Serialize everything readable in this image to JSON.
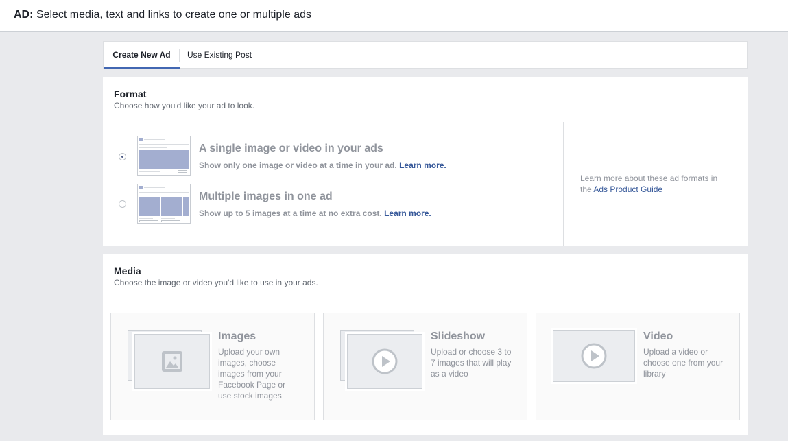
{
  "header": {
    "prefix": "AD:",
    "title": "Select media, text and links to create one or multiple ads"
  },
  "tabs": [
    {
      "label": "Create New Ad",
      "active": true
    },
    {
      "label": "Use Existing Post",
      "active": false
    }
  ],
  "format": {
    "title": "Format",
    "subtitle": "Choose how you'd like your ad to look.",
    "options": [
      {
        "title": "A single image or video in your ads",
        "description": "Show only one image or video at a time in your ad.",
        "link": "Learn more.",
        "selected": true
      },
      {
        "title": "Multiple images in one ad",
        "description": "Show up to 5 images at a time at no extra cost.",
        "link": "Learn more.",
        "selected": false
      }
    ],
    "side_note": "Learn more about these ad formats in the",
    "side_link": "Ads Product Guide"
  },
  "media": {
    "title": "Media",
    "subtitle": "Choose the image or video you'd like to use in your ads.",
    "options": [
      {
        "title": "Images",
        "description": "Upload your own images, choose images from your Facebook Page or use stock images",
        "icon": "image-icon"
      },
      {
        "title": "Slideshow",
        "description": "Upload or choose 3 to 7 images that will play as a video",
        "icon": "play-icon"
      },
      {
        "title": "Video",
        "description": "Upload a video or choose one from your library",
        "icon": "play-icon"
      }
    ]
  },
  "colors": {
    "accent": "#4267b2",
    "link": "#365899",
    "muted_text": "#90949c",
    "thumb_fill": "#a3aed0",
    "page_bg": "#e9eaed"
  }
}
